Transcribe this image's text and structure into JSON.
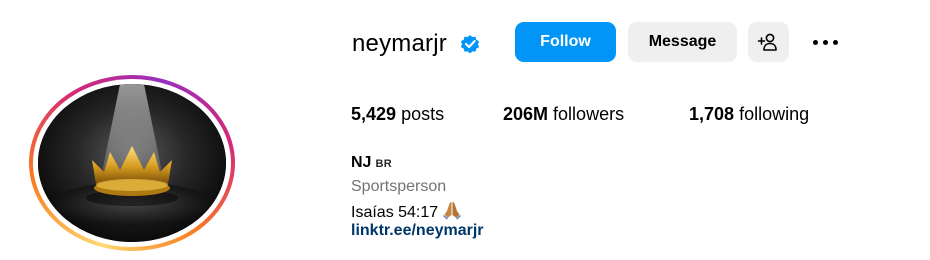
{
  "profile": {
    "username": "neymarjr",
    "verified": true,
    "name": "NJ",
    "pronoun": "BR",
    "category": "Sportsperson",
    "bio": "Isaías 54:17",
    "bio_emoji": "folded-hands",
    "link": "linktr.ee/neymarjr"
  },
  "actions": {
    "follow_label": "Follow",
    "message_label": "Message",
    "add_user_icon": "add-user-icon",
    "more_icon": "more-options-icon"
  },
  "stats": {
    "posts_count": "5,429",
    "posts_label": "posts",
    "followers_count": "206M",
    "followers_label": "followers",
    "following_count": "1,708",
    "following_label": "following"
  },
  "colors": {
    "follow_button": "#0095f6",
    "secondary_button": "#efefef",
    "verified_badge": "#0095f6",
    "link": "#00376b",
    "category_text": "#737373"
  }
}
